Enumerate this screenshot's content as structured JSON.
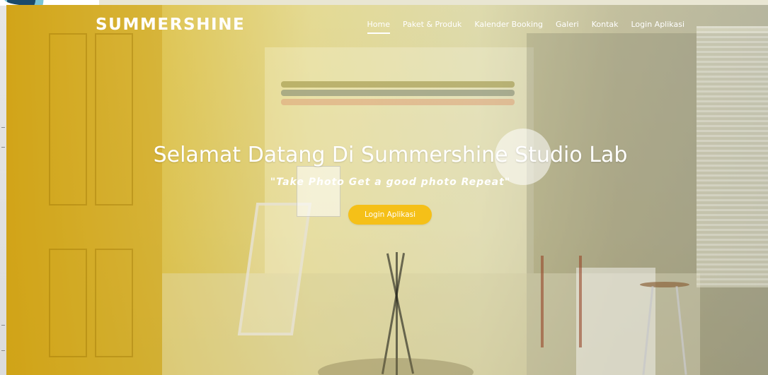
{
  "brand": {
    "name": "SUMMERSHINE"
  },
  "nav": {
    "items": [
      {
        "label": "Home",
        "active": true
      },
      {
        "label": "Paket & Produk",
        "active": false
      },
      {
        "label": "Kalender Booking",
        "active": false
      },
      {
        "label": "Galeri",
        "active": false
      },
      {
        "label": "Kontak",
        "active": false
      },
      {
        "label": "Login Aplikasi",
        "active": false
      }
    ]
  },
  "hero": {
    "headline": "Selamat Datang Di Summershine Studio Lab",
    "tagline": "\"Take Photo Get a good photo Repeat\"",
    "cta_label": "Login Aplikasi"
  },
  "colors": {
    "accent": "#f5c018",
    "overlay_left": "#d6aa18",
    "text": "#ffffff"
  },
  "icons": {
    "corner": "partial-logo-icon"
  }
}
